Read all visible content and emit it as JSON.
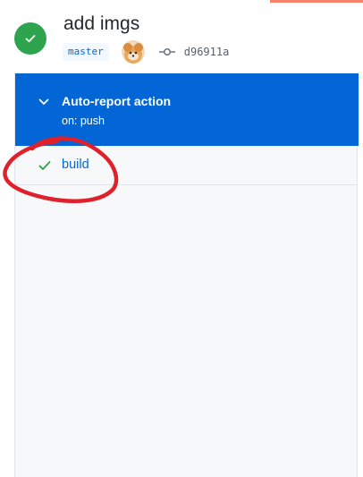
{
  "run": {
    "title": "add imgs",
    "status": "success",
    "branch": "master",
    "commit_sha": "d96911a"
  },
  "workflow": {
    "name": "Auto-report action",
    "trigger": "on: push"
  },
  "jobs": [
    {
      "name": "build",
      "status": "success"
    }
  ],
  "colors": {
    "success": "#2ea44f",
    "accent": "#0366d6",
    "annotation": "#e0202a",
    "top_bar": "#f9826c"
  },
  "icons": [
    "check-circle-icon",
    "avatar",
    "git-commit-icon",
    "chevron-down-icon",
    "check-icon"
  ]
}
